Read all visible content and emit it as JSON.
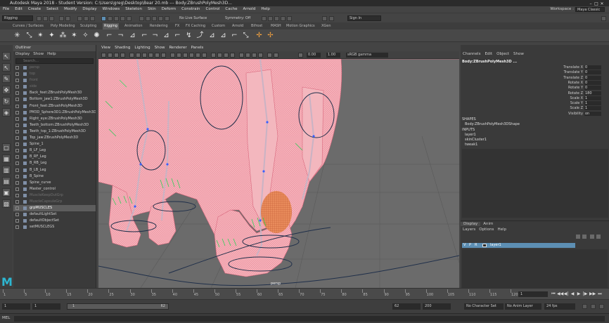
{
  "window": {
    "title": "Autodesk Maya 2018 - Student Version: C:\\Users\\greg\\Desktop\\Bear 20.mb  ---  Body:ZBrushPolyMesh3D...",
    "controls": [
      "–",
      "□",
      "✕"
    ]
  },
  "menu": {
    "items": [
      "File",
      "Edit",
      "Create",
      "Select",
      "Modify",
      "Display",
      "Windows",
      "Skeleton",
      "Skin",
      "Deform",
      "Constrain",
      "Control",
      "Cache",
      "Arnold",
      "Help"
    ],
    "workspace_label": "Workspace :",
    "workspace_value": "Maya Classic"
  },
  "status_line": {
    "mode": "Rigging",
    "live_surface": "No Live Surface",
    "symmetry": "Symmetry: Off",
    "sign_in": "Sign In"
  },
  "shelf": {
    "tabs": [
      "Curves / Surfaces",
      "Poly Modeling",
      "Sculpting",
      "Rigging",
      "Animation",
      "Rendering",
      "FX",
      "FX Caching",
      "Custom",
      "Arnold",
      "Bifrost",
      "MASH",
      "Motion Graphics",
      "XGen"
    ],
    "active_tab": "Rigging",
    "icons": [
      "joint-icon",
      "ik-handle-icon",
      "ik-spline-icon",
      "insert-joint-icon",
      "mirror-joint-icon",
      "orient-joint-icon",
      "bind-skin-icon",
      "paint-weights-icon",
      "smooth-bind-icon",
      "detach-skin-icon",
      "cluster-icon",
      "lattice-icon",
      "wire-icon",
      "soft-mod-icon",
      "sculpt-icon",
      "point-constraint-icon",
      "aim-constraint-icon",
      "orient-constraint-icon",
      "scale-constraint-icon",
      "parent-constraint-icon",
      "pole-vector-icon",
      "locator-icon",
      "hik-icon"
    ]
  },
  "outliner": {
    "title": "Outliner",
    "menu": [
      "Display",
      "Show",
      "Help"
    ],
    "search_placeholder": "Search...",
    "rows": [
      {
        "label": "persp",
        "state": "dim"
      },
      {
        "label": "top",
        "state": "dim"
      },
      {
        "label": "front",
        "state": "dim"
      },
      {
        "label": "side",
        "state": "dim"
      },
      {
        "label": "Back_feet:ZBrushPolyMesh3D",
        "state": "normal"
      },
      {
        "label": "Bottom_jaw1:ZBrushPolyMesh3D",
        "state": "normal"
      },
      {
        "label": "Front_feet:ZBrushPolyMesh3D",
        "state": "normal"
      },
      {
        "label": "PM3D_Sphere3D1:ZBrushPolyMesh3D",
        "state": "normal"
      },
      {
        "label": "Right_eye:ZBrushPolyMesh3D",
        "state": "normal"
      },
      {
        "label": "Teeth_bottom:ZBrushPolyMesh3D",
        "state": "normal"
      },
      {
        "label": "Teeth_top_1:ZBrushPolyMesh3D",
        "state": "normal"
      },
      {
        "label": "Top_jaw:ZBrushPolyMesh3D",
        "state": "normal"
      },
      {
        "label": "Spine_1",
        "state": "normal"
      },
      {
        "label": "B_LF_Leg",
        "state": "normal"
      },
      {
        "label": "B_RF_Leg",
        "state": "normal"
      },
      {
        "label": "B_RB_Leg",
        "state": "normal"
      },
      {
        "label": "B_LB_Leg",
        "state": "normal"
      },
      {
        "label": "B_Spine",
        "state": "normal"
      },
      {
        "label": "Spine_curve",
        "state": "normal"
      },
      {
        "label": "Master_control",
        "state": "normal"
      },
      {
        "label": "MuscleKeepOutGrp",
        "state": "dim"
      },
      {
        "label": "MuscleCapsuleGrp",
        "state": "dim"
      },
      {
        "label": "grpMUSCLES",
        "state": "selected"
      },
      {
        "label": "defaultLightSet",
        "state": "normal"
      },
      {
        "label": "defaultObjectSet",
        "state": "normal"
      },
      {
        "label": "setMUSCLEGS",
        "state": "normal"
      }
    ]
  },
  "viewport": {
    "menu": [
      "View",
      "Shading",
      "Lighting",
      "Show",
      "Renderer",
      "Panels"
    ],
    "near_value": "0.00",
    "far_value": "1.00",
    "color_space": "sRGB gamma",
    "camera_label": "persp"
  },
  "channel_box": {
    "menu": [
      "Channels",
      "Edit",
      "Object",
      "Show"
    ],
    "object_name": "Body:ZBrushPolyMesh3D ...",
    "attributes": [
      {
        "name": "Translate X",
        "value": "0"
      },
      {
        "name": "Translate Y",
        "value": "0"
      },
      {
        "name": "Translate Z",
        "value": "0"
      },
      {
        "name": "Rotate X",
        "value": "0"
      },
      {
        "name": "Rotate Y",
        "value": "0"
      },
      {
        "name": "Rotate Z",
        "value": "180"
      },
      {
        "name": "Scale X",
        "value": "1"
      },
      {
        "name": "Scale Y",
        "value": "1"
      },
      {
        "name": "Scale Z",
        "value": "1"
      },
      {
        "name": "Visibility",
        "value": "on"
      }
    ],
    "shapes_label": "SHAPES",
    "shape_name": "Body:ZBrushPolyMesh3DShape",
    "inputs_label": "INPUTS",
    "inputs": [
      "layer1",
      "skinCluster1",
      "tweak1"
    ]
  },
  "layer_editor": {
    "tabs": [
      "Display",
      "Anim"
    ],
    "menu": [
      "Layers",
      "Options",
      "Help"
    ],
    "layer": {
      "v": "V",
      "p": "P",
      "r": "R",
      "name": "layer1"
    }
  },
  "time_slider": {
    "ticks": [
      "1",
      "5",
      "10",
      "15",
      "20",
      "25",
      "30",
      "35",
      "40",
      "45",
      "50",
      "55",
      "60",
      "65",
      "70",
      "75",
      "80",
      "85",
      "90",
      "95",
      "100",
      "105",
      "110",
      "115",
      "120"
    ],
    "current_frame": "1",
    "playback": [
      "⏮",
      "◀◀",
      "◀|",
      "◀",
      "▶",
      "|▶",
      "▶▶",
      "⏭"
    ]
  },
  "range_slider": {
    "start": "1",
    "inner_start": "1",
    "bar_start": "1",
    "bar_end": "62",
    "inner_end": "62",
    "end": "200",
    "character_set": "No Character Set",
    "anim_layer": "No Anim Layer",
    "fps": "24 fps"
  },
  "command_line": {
    "lang": "MEL"
  },
  "colors": {
    "mesh": "#f4a7b0",
    "wire": "#e06a80",
    "bg": "#6b6b6b",
    "accent_select": "#5d8fb4",
    "maya_logo": "#2db6d1"
  }
}
